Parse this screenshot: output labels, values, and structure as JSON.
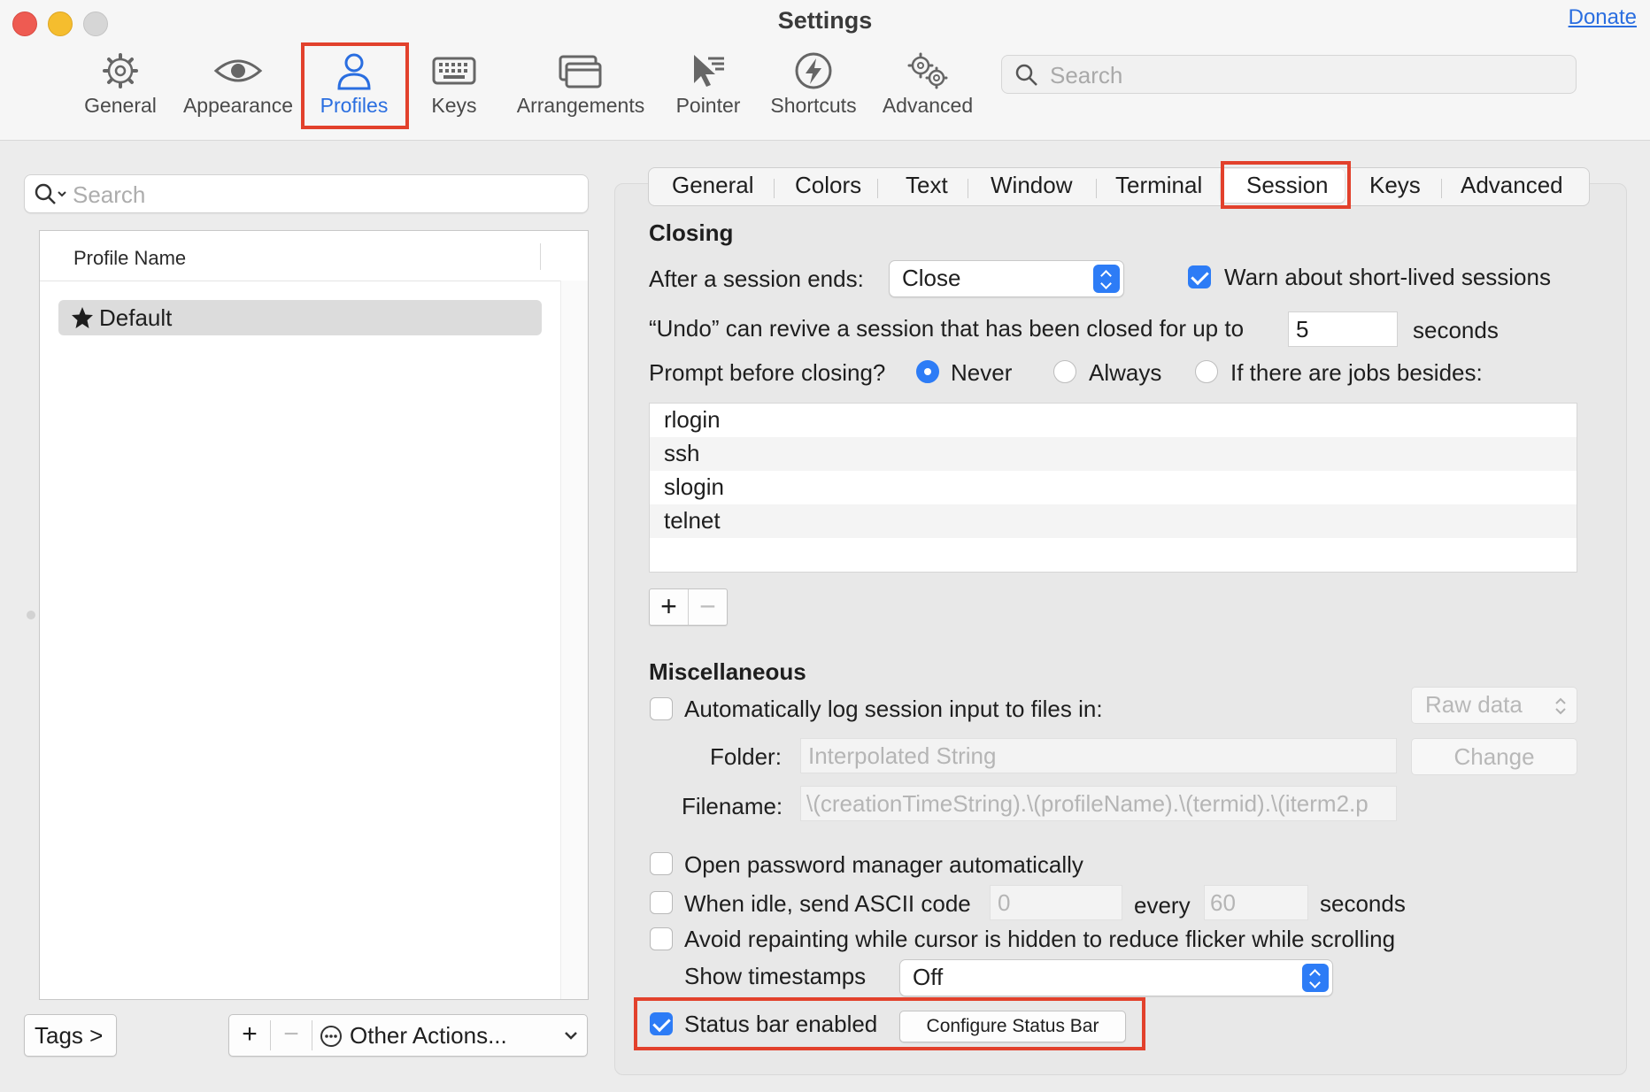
{
  "window": {
    "title": "Settings",
    "donate_link": "Donate"
  },
  "toolbar": {
    "items": [
      {
        "label": "General",
        "icon": "gear-icon"
      },
      {
        "label": "Appearance",
        "icon": "eye-icon"
      },
      {
        "label": "Profiles",
        "icon": "person-icon",
        "selected": true
      },
      {
        "label": "Keys",
        "icon": "keyboard-icon"
      },
      {
        "label": "Arrangements",
        "icon": "windows-icon"
      },
      {
        "label": "Pointer",
        "icon": "pointer-icon"
      },
      {
        "label": "Shortcuts",
        "icon": "bolt-icon"
      },
      {
        "label": "Advanced",
        "icon": "gears-icon"
      }
    ],
    "search_placeholder": "Search"
  },
  "profiles": {
    "search_placeholder": "Search",
    "column_header": "Profile Name",
    "rows": [
      {
        "name": "Default",
        "is_default": true
      }
    ],
    "tags_button": "Tags >",
    "add_button": "+",
    "remove_button": "−",
    "other_actions": "Other Actions..."
  },
  "tabs": [
    "General",
    "Colors",
    "Text",
    "Window",
    "Terminal",
    "Session",
    "Keys",
    "Advanced"
  ],
  "selected_tab": "Session",
  "closing": {
    "title": "Closing",
    "after_session_label": "After a session ends:",
    "after_session_value": "Close",
    "warn_short_lived": {
      "label": "Warn about short-lived sessions",
      "checked": true
    },
    "undo_label": "“Undo” can revive a session that has been closed for up to",
    "undo_value": "5",
    "undo_unit": "seconds",
    "prompt_label": "Prompt before closing?",
    "prompt_options": [
      "Never",
      "Always",
      "If there are jobs besides:"
    ],
    "prompt_selected": "Never",
    "jobs": [
      "rlogin",
      "ssh",
      "slogin",
      "telnet"
    ],
    "add_job": "+",
    "remove_job": "−"
  },
  "misc": {
    "title": "Miscellaneous",
    "auto_log": {
      "label": "Automatically log session input to files in:",
      "checked": false
    },
    "log_format": "Raw data",
    "folder_label": "Folder:",
    "folder_placeholder": "Interpolated String",
    "change_button": "Change",
    "filename_label": "Filename:",
    "filename_value": "\\(creationTimeString).\\(profileName).\\(termid).\\(iterm2.p",
    "password_manager": {
      "label": "Open password manager automatically",
      "checked": false
    },
    "idle": {
      "label": "When idle, send ASCII code",
      "checked": false,
      "code_placeholder": "0",
      "every_label": "every",
      "interval_placeholder": "60",
      "unit": "seconds"
    },
    "avoid_repaint": {
      "label": "Avoid repainting while cursor is hidden to reduce flicker while scrolling",
      "checked": false
    },
    "timestamps_label": "Show timestamps",
    "timestamps_value": "Off",
    "status_bar": {
      "label": "Status bar enabled",
      "checked": true
    },
    "configure_status_bar": "Configure Status Bar"
  },
  "colors": {
    "accent": "#2d7cf6",
    "highlight_box": "#e2412c",
    "selected_toolbar_text": "#2a6ee0"
  }
}
